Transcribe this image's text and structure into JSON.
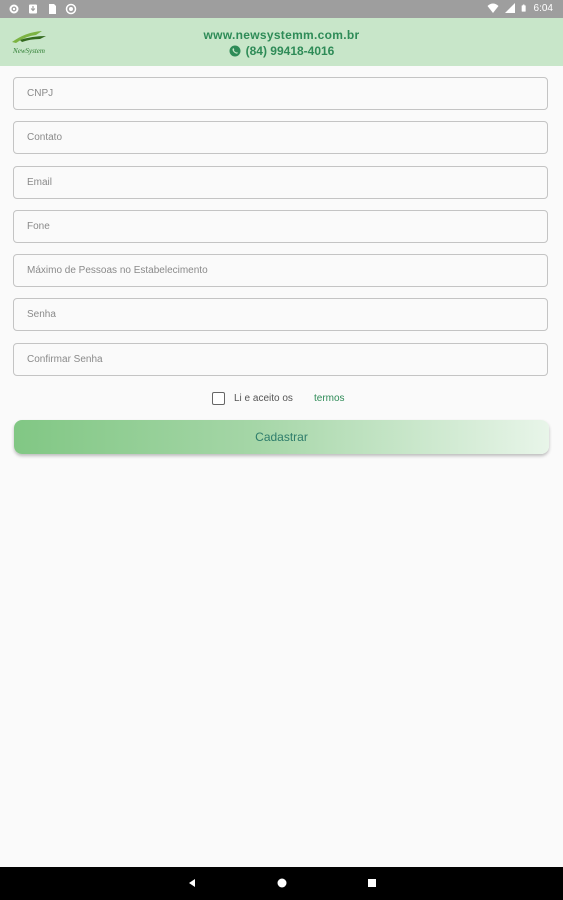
{
  "status_bar": {
    "time": "6:04",
    "left_icons": [
      "gear-icon",
      "download-icon",
      "sd-card-icon",
      "circle-icon"
    ],
    "right_icons": [
      "wifi-icon",
      "signal-icon",
      "battery-icon"
    ]
  },
  "header": {
    "logo_text": "NewSystem",
    "url": "www.newsystemm.com.br",
    "phone": "(84) 99418-4016",
    "phone_icon": "whatsapp-icon"
  },
  "form": {
    "fields": [
      {
        "name": "cnpj",
        "placeholder": "CNPJ",
        "value": ""
      },
      {
        "name": "contato",
        "placeholder": "Contato",
        "value": ""
      },
      {
        "name": "email",
        "placeholder": "Email",
        "value": ""
      },
      {
        "name": "fone",
        "placeholder": "Fone",
        "value": ""
      },
      {
        "name": "max-pessoas",
        "placeholder": "Máximo de Pessoas no Estabelecimento",
        "value": ""
      },
      {
        "name": "senha",
        "placeholder": "Senha",
        "value": ""
      },
      {
        "name": "confirmar-senha",
        "placeholder": "Confirmar Senha",
        "value": ""
      }
    ],
    "terms_text": "Li e aceito os",
    "terms_link": "termos",
    "terms_checked": false,
    "submit_label": "Cadastrar"
  },
  "nav_bar": {
    "buttons": [
      "back-icon",
      "home-icon",
      "recents-icon"
    ]
  },
  "colors": {
    "header_bg": "#c8e6c9",
    "accent": "#2e8b57",
    "button_gradient_start": "#81c784",
    "button_gradient_end": "#e8f5e9"
  }
}
